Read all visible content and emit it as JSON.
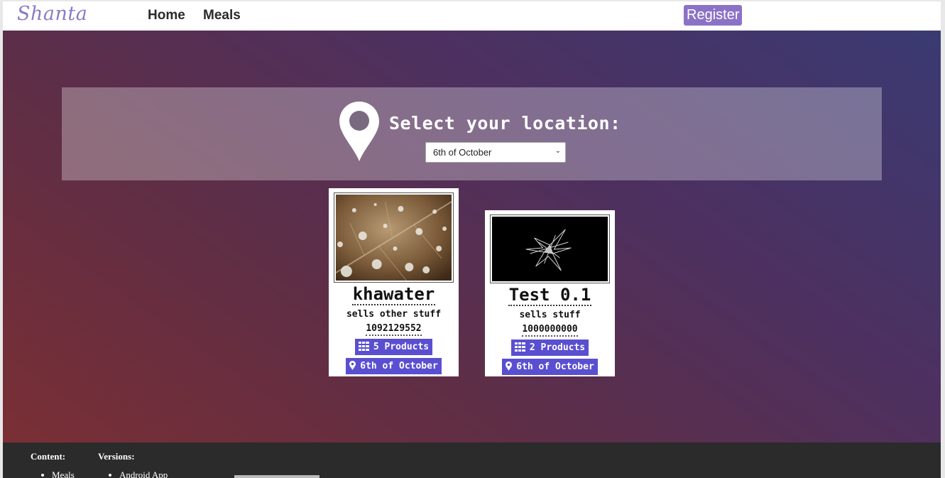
{
  "nav": {
    "logo": "Shanta",
    "links": [
      "Home",
      "Meals"
    ],
    "register": "Register"
  },
  "location": {
    "title": "Select your location:",
    "selected": "6th of October"
  },
  "cards": [
    {
      "name": "khawater",
      "description": "sells other stuff",
      "phone": "1092129552",
      "products": "5 Products",
      "location": "6th of October"
    },
    {
      "name": "Test 0.1",
      "description": "sells stuff",
      "phone": "1000000000",
      "products": "2 Products",
      "location": "6th of October"
    }
  ],
  "footer": {
    "content_heading": "Content:",
    "content_items": [
      "Meals"
    ],
    "versions_heading": "Versions:",
    "versions_items": [
      "Android App"
    ]
  },
  "colors": {
    "brand": "#8a72c6",
    "badge": "#5a4fd0",
    "footer": "#2b2b2b"
  }
}
